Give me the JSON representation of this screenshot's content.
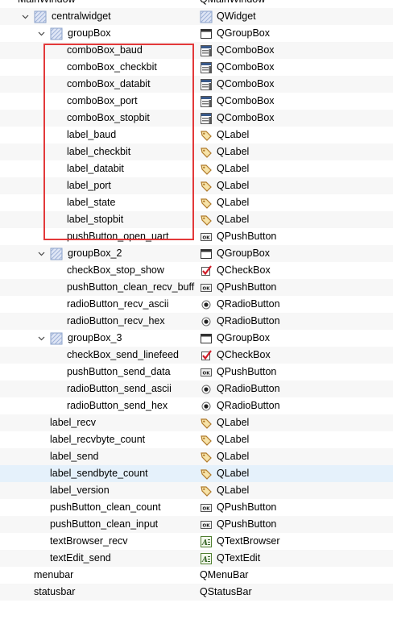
{
  "tree": {
    "rows": [
      {
        "name": "MainWindow",
        "cls": "QMainWindow",
        "depth": 0,
        "icon": "none",
        "cicon": "none",
        "clipped": true
      },
      {
        "name": "centralwidget",
        "cls": "QWidget",
        "depth": 1,
        "icon": "widget",
        "cicon": "widget",
        "exp": "expanded"
      },
      {
        "name": "groupBox",
        "cls": "QGroupBox",
        "depth": 2,
        "icon": "widget",
        "cicon": "groupbox",
        "exp": "expanded"
      },
      {
        "name": "comboBox_baud",
        "cls": "QComboBox",
        "depth": 3,
        "cicon": "combobox"
      },
      {
        "name": "comboBox_checkbit",
        "cls": "QComboBox",
        "depth": 3,
        "cicon": "combobox"
      },
      {
        "name": "comboBox_databit",
        "cls": "QComboBox",
        "depth": 3,
        "cicon": "combobox"
      },
      {
        "name": "comboBox_port",
        "cls": "QComboBox",
        "depth": 3,
        "cicon": "combobox"
      },
      {
        "name": "comboBox_stopbit",
        "cls": "QComboBox",
        "depth": 3,
        "cicon": "combobox"
      },
      {
        "name": "label_baud",
        "cls": "QLabel",
        "depth": 3,
        "cicon": "label"
      },
      {
        "name": "label_checkbit",
        "cls": "QLabel",
        "depth": 3,
        "cicon": "label"
      },
      {
        "name": "label_databit",
        "cls": "QLabel",
        "depth": 3,
        "cicon": "label"
      },
      {
        "name": "label_port",
        "cls": "QLabel",
        "depth": 3,
        "cicon": "label"
      },
      {
        "name": "label_state",
        "cls": "QLabel",
        "depth": 3,
        "cicon": "label"
      },
      {
        "name": "label_stopbit",
        "cls": "QLabel",
        "depth": 3,
        "cicon": "label"
      },
      {
        "name": "pushButton_open_uart",
        "cls": "QPushButton",
        "depth": 3,
        "cicon": "pushbutton"
      },
      {
        "name": "groupBox_2",
        "cls": "QGroupBox",
        "depth": 2,
        "icon": "widget",
        "cicon": "groupbox",
        "exp": "expanded"
      },
      {
        "name": "checkBox_stop_show",
        "cls": "QCheckBox",
        "depth": 3,
        "cicon": "checkbox"
      },
      {
        "name": "pushButton_clean_recv_buff",
        "cls": "QPushButton",
        "depth": 3,
        "cicon": "pushbutton"
      },
      {
        "name": "radioButton_recv_ascii",
        "cls": "QRadioButton",
        "depth": 3,
        "cicon": "radiobutton"
      },
      {
        "name": "radioButton_recv_hex",
        "cls": "QRadioButton",
        "depth": 3,
        "cicon": "radiobutton"
      },
      {
        "name": "groupBox_3",
        "cls": "QGroupBox",
        "depth": 2,
        "icon": "widget",
        "cicon": "groupbox",
        "exp": "expanded"
      },
      {
        "name": "checkBox_send_linefeed",
        "cls": "QCheckBox",
        "depth": 3,
        "cicon": "checkbox"
      },
      {
        "name": "pushButton_send_data",
        "cls": "QPushButton",
        "depth": 3,
        "cicon": "pushbutton"
      },
      {
        "name": "radioButton_send_ascii",
        "cls": "QRadioButton",
        "depth": 3,
        "cicon": "radiobutton"
      },
      {
        "name": "radioButton_send_hex",
        "cls": "QRadioButton",
        "depth": 3,
        "cicon": "radiobutton"
      },
      {
        "name": "label_recv",
        "cls": "QLabel",
        "depth": 2,
        "cicon": "label"
      },
      {
        "name": "label_recvbyte_count",
        "cls": "QLabel",
        "depth": 2,
        "cicon": "label"
      },
      {
        "name": "label_send",
        "cls": "QLabel",
        "depth": 2,
        "cicon": "label"
      },
      {
        "name": "label_sendbyte_count",
        "cls": "QLabel",
        "depth": 2,
        "cicon": "label",
        "highlight": true
      },
      {
        "name": "label_version",
        "cls": "QLabel",
        "depth": 2,
        "cicon": "label"
      },
      {
        "name": "pushButton_clean_count",
        "cls": "QPushButton",
        "depth": 2,
        "cicon": "pushbutton"
      },
      {
        "name": "pushButton_clean_input",
        "cls": "QPushButton",
        "depth": 2,
        "cicon": "pushbutton"
      },
      {
        "name": "textBrowser_recv",
        "cls": "QTextBrowser",
        "depth": 2,
        "cicon": "textedit"
      },
      {
        "name": "textEdit_send",
        "cls": "QTextEdit",
        "depth": 2,
        "cicon": "textedit"
      },
      {
        "name": "menubar",
        "cls": "QMenuBar",
        "depth": 1,
        "cicon": "none"
      },
      {
        "name": "statusbar",
        "cls": "QStatusBar",
        "depth": 1,
        "cicon": "none"
      }
    ],
    "selection_frame_color": "#e3393a",
    "highlight_color": "#e5f1fb"
  }
}
